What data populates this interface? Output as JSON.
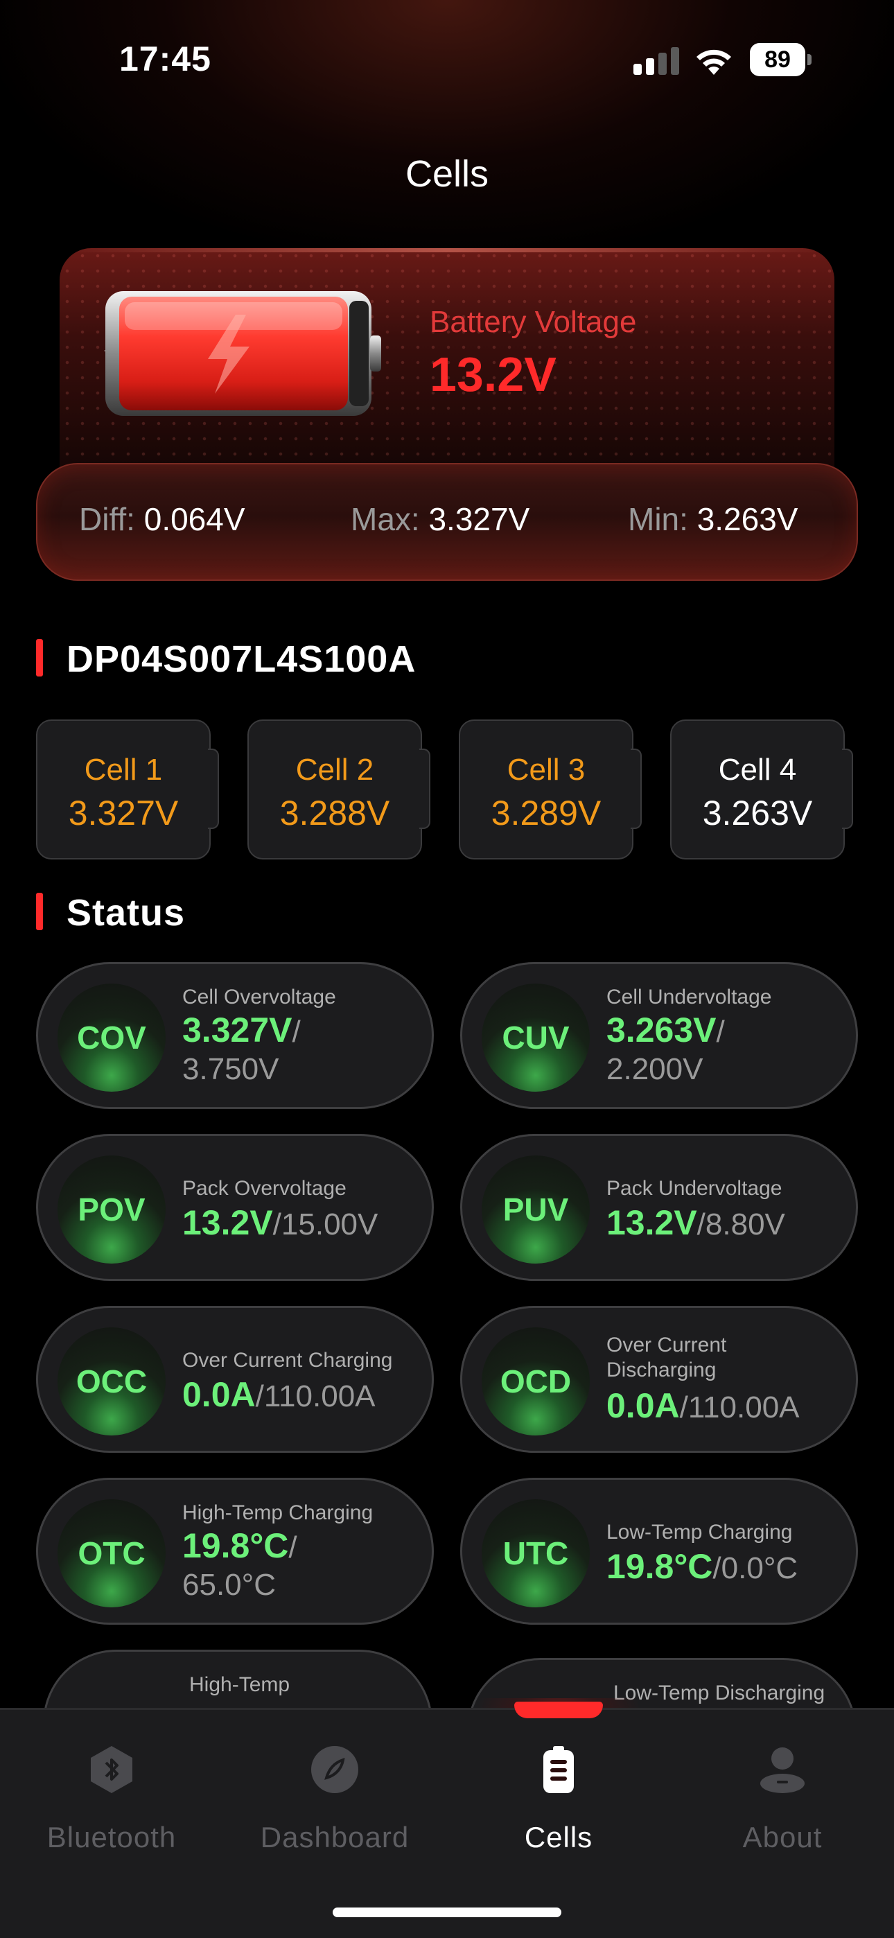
{
  "status_bar": {
    "time": "17:45",
    "battery_level": "89"
  },
  "header": {
    "title": "Cells"
  },
  "battery": {
    "label": "Battery Voltage",
    "value": "13.2V",
    "accent_color": "#ff2a2a"
  },
  "stats": {
    "diff_label": "Diff:",
    "diff_value": "0.064V",
    "max_label": "Max:",
    "max_value": "3.327V",
    "min_label": "Min:",
    "min_value": "3.263V"
  },
  "device": {
    "name": "DP04S007L4S100A"
  },
  "cells": [
    {
      "name": "Cell 1",
      "value": "3.327V",
      "state": "warn"
    },
    {
      "name": "Cell 2",
      "value": "3.288V",
      "state": "warn"
    },
    {
      "name": "Cell 3",
      "value": "3.289V",
      "state": "warn"
    },
    {
      "name": "Cell 4",
      "value": "3.263V",
      "state": "normal"
    }
  ],
  "status_section": {
    "title": "Status"
  },
  "status_items": [
    {
      "code": "COV",
      "label": "Cell Overvoltage",
      "value": "3.327V",
      "limit": "/",
      "limit2": "3.750V"
    },
    {
      "code": "CUV",
      "label": "Cell Undervoltage",
      "value": "3.263V",
      "limit": "/",
      "limit2": "2.200V"
    },
    {
      "code": "POV",
      "label": "Pack Overvoltage",
      "value": "13.2V",
      "limit": "/15.00V"
    },
    {
      "code": "PUV",
      "label": "Pack Undervoltage",
      "value": "13.2V",
      "limit": "/8.80V"
    },
    {
      "code": "OCC",
      "label": "Over Current Charging",
      "value": "0.0A",
      "limit": "/110.00A"
    },
    {
      "code": "OCD",
      "label": "Over Current",
      "label2": "Discharging",
      "value": "0.0A",
      "limit": "/110.00A"
    },
    {
      "code": "OTC",
      "label": "High-Temp Charging",
      "value": "19.8°C",
      "limit": "/",
      "limit2": "65.0°C"
    },
    {
      "code": "UTC",
      "label": "Low-Temp Charging",
      "value": "19.8°C",
      "limit": "/0.0°C"
    },
    {
      "label": "High-Temp"
    },
    {
      "label": "Low-Temp Discharging"
    }
  ],
  "tabs": [
    {
      "label": "Bluetooth",
      "icon": "bluetooth-icon"
    },
    {
      "label": "Dashboard",
      "icon": "dashboard-icon"
    },
    {
      "label": "Cells",
      "icon": "battery-icon",
      "active": true
    },
    {
      "label": "About",
      "icon": "person-icon"
    }
  ],
  "colors": {
    "ok_green": "#6cf07a",
    "warn_orange": "#f29a1a",
    "background": "#000000",
    "card": "#1c1c1e"
  }
}
